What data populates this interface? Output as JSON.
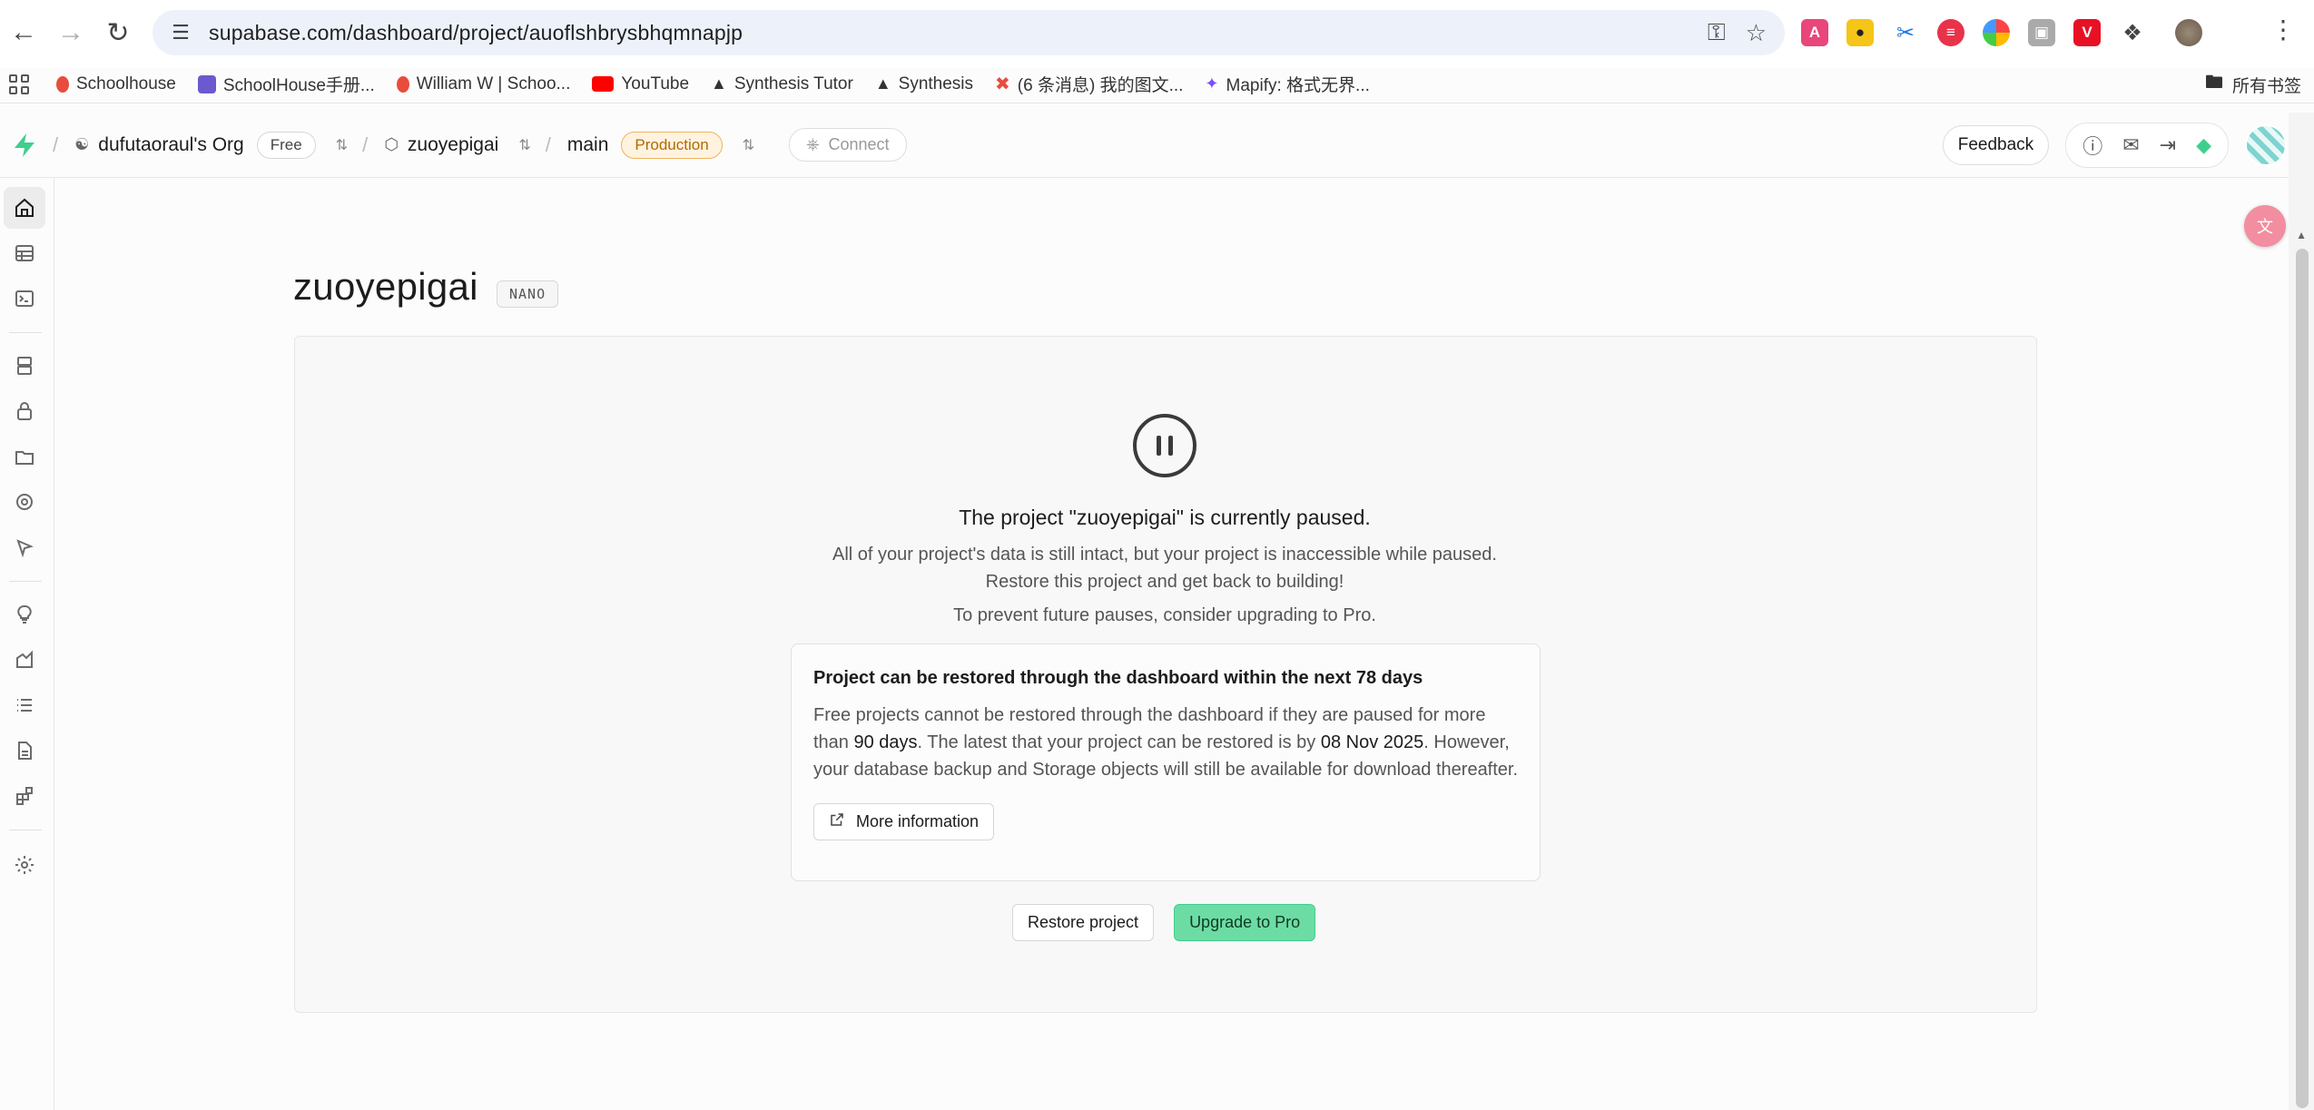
{
  "browser": {
    "url": "supabase.com/dashboard/project/auoflshbrysbhqmnapjp",
    "bookmarks": [
      {
        "label": "Schoolhouse",
        "color": "#e84c3d"
      },
      {
        "label": "SchoolHouse手册...",
        "color": "#6a5acd"
      },
      {
        "label": "William W | Schoo...",
        "color": "#e84c3d"
      },
      {
        "label": "YouTube",
        "color": "#ff0000"
      },
      {
        "label": "Synthesis Tutor",
        "color": "#222222"
      },
      {
        "label": "Synthesis",
        "color": "#222222"
      },
      {
        "label": "(6 条消息) 我的图文...",
        "color": "#2c7be5"
      },
      {
        "label": "Mapify: 格式无界...",
        "color": "#7b4dff"
      }
    ],
    "bookmarks_folder": "所有书签"
  },
  "appbar": {
    "org_name": "dufutaoraul's Org",
    "org_plan": "Free",
    "project_name": "zuoyepigai",
    "branch": "main",
    "env_badge": "Production",
    "connect_label": "Connect",
    "feedback_label": "Feedback"
  },
  "main": {
    "title": "zuoyepigai",
    "size_badge": "NANO",
    "paused_title": "The project \"zuoyepigai\" is currently paused.",
    "paused_desc_line1": "All of your project's data is still intact, but your project is inaccessible while paused.",
    "paused_desc_line2": "Restore this project and get back to building!",
    "paused_upgrade_hint": "To prevent future pauses, consider upgrading to Pro.",
    "restore_box": {
      "title": "Project can be restored through the dashboard within the next 78 days",
      "body_part1": "Free projects cannot be restored through the dashboard if they are paused for more than ",
      "body_days": "90 days",
      "body_part2": ". The latest that your project can be restored is by ",
      "body_date": "08 Nov 2025",
      "body_part3": ". However, your database backup and Storage objects will still be available for download thereafter.",
      "more_info_label": "More information"
    },
    "restore_button": "Restore project",
    "upgrade_button": "Upgrade to Pro"
  },
  "colors": {
    "brand_green": "#3ecf8e",
    "production_badge": "#f0b35a"
  }
}
